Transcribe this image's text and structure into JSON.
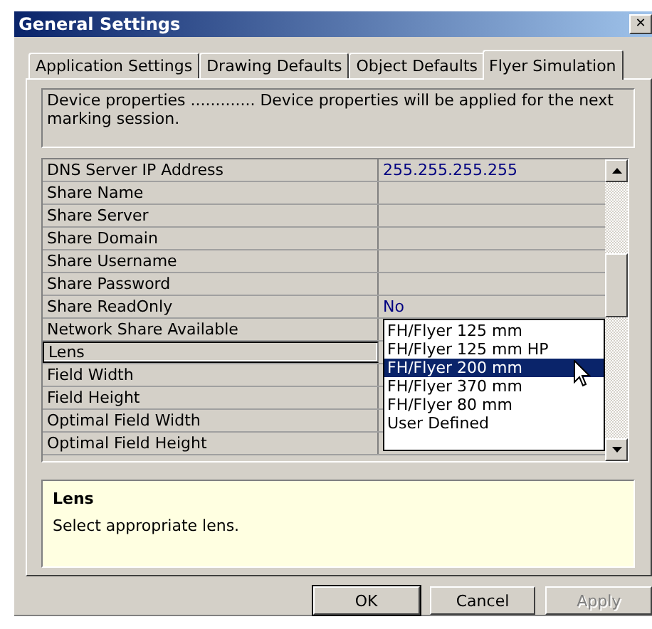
{
  "window": {
    "title": "General Settings",
    "close": "✕"
  },
  "tabs": [
    {
      "label": "Application Settings",
      "selected": false
    },
    {
      "label": "Drawing Defaults",
      "selected": false
    },
    {
      "label": "Object Defaults",
      "selected": false
    },
    {
      "label": "Flyer Simulation",
      "selected": true
    }
  ],
  "description": "Device properties ............. Device properties will be applied for the next marking session.",
  "grid": {
    "rows": [
      {
        "name": "DNS Server IP Address",
        "value": "255.255.255.255",
        "selected": false
      },
      {
        "name": "Share Name",
        "selected": false
      },
      {
        "name": "Share Server",
        "selected": false
      },
      {
        "name": "Share Domain",
        "selected": false
      },
      {
        "name": "Share Username",
        "selected": false
      },
      {
        "name": "Share Password",
        "selected": false
      },
      {
        "name": "Share ReadOnly",
        "value": "No",
        "selected": false
      },
      {
        "name": "Network Share Available",
        "selected": false
      },
      {
        "name": "Lens",
        "selected": true
      },
      {
        "name": "Field Width",
        "selected": false
      },
      {
        "name": "Field Height",
        "selected": false
      },
      {
        "name": "Optimal Field Width",
        "selected": false
      },
      {
        "name": "Optimal Field Height",
        "selected": false
      }
    ],
    "dropdown": [
      {
        "label": "FH/Flyer 125 mm",
        "selected": false
      },
      {
        "label": "FH/Flyer 125 mm HP",
        "selected": false
      },
      {
        "label": "FH/Flyer 200 mm",
        "selected": true
      },
      {
        "label": "FH/Flyer 370 mm",
        "selected": false
      },
      {
        "label": "FH/Flyer 80 mm",
        "selected": false
      },
      {
        "label": "User Defined",
        "selected": false
      }
    ]
  },
  "help": {
    "title": "Lens",
    "text": "Select appropriate lens."
  },
  "buttons": [
    {
      "label": "OK",
      "default": true,
      "disabled": false
    },
    {
      "label": "Cancel",
      "default": false,
      "disabled": false
    },
    {
      "label": "Apply",
      "default": false,
      "disabled": true
    }
  ]
}
